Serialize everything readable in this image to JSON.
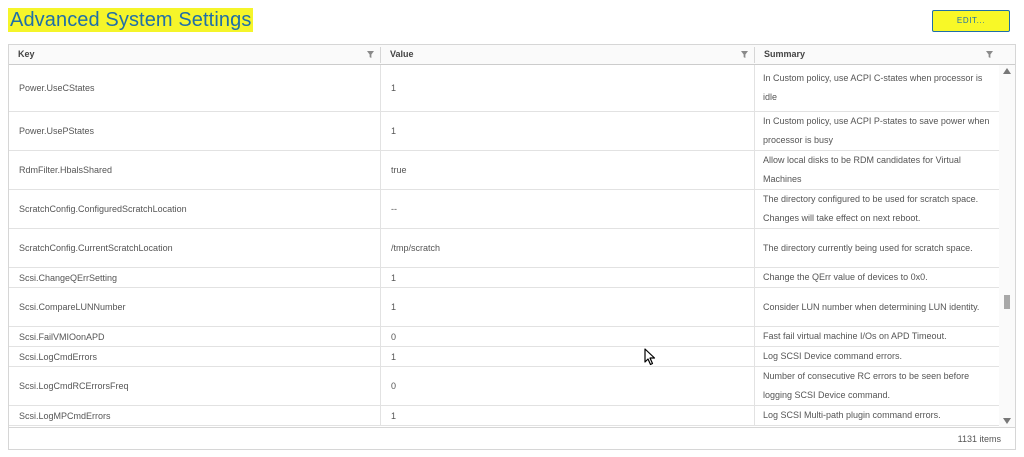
{
  "page": {
    "title": "Advanced System Settings",
    "edit_label": "EDIT..."
  },
  "colors": {
    "highlight": "#f5f52a",
    "accent": "#1f6fa8"
  },
  "grid": {
    "columns": [
      "Key",
      "Value",
      "Summary"
    ],
    "rows": [
      {
        "key": "Power.UseCStates",
        "value": "1",
        "summary": "In Custom policy, use ACPI C-states when processor is idle"
      },
      {
        "key": "Power.UsePStates",
        "value": "1",
        "summary": "In Custom policy, use ACPI P-states to save power when processor is busy"
      },
      {
        "key": "RdmFilter.HbalsShared",
        "value": "true",
        "summary": "Allow local disks to be RDM candidates for Virtual Machines"
      },
      {
        "key": "ScratchConfig.ConfiguredScratchLocation",
        "value": "--",
        "summary": "The directory configured to be used for scratch space. Changes will take effect on next reboot."
      },
      {
        "key": "ScratchConfig.CurrentScratchLocation",
        "value": "/tmp/scratch",
        "summary": "The directory currently being used for scratch space."
      },
      {
        "key": "Scsi.ChangeQErrSetting",
        "value": "1",
        "summary": "Change the QErr value of devices to 0x0."
      },
      {
        "key": "Scsi.CompareLUNNumber",
        "value": "1",
        "summary": "Consider LUN number when determining LUN identity."
      },
      {
        "key": "Scsi.FailVMIOonAPD",
        "value": "0",
        "summary": "Fast fail virtual machine I/Os on APD Timeout."
      },
      {
        "key": "Scsi.LogCmdErrors",
        "value": "1",
        "summary": "Log SCSI Device command errors."
      },
      {
        "key": "Scsi.LogCmdRCErrorsFreq",
        "value": "0",
        "summary": "Number of consecutive RC errors to be seen before logging SCSI Device command."
      },
      {
        "key": "Scsi.LogMPCmdErrors",
        "value": "1",
        "summary": "Log SCSI Multi-path plugin command errors."
      }
    ],
    "footer": {
      "items_count": "1131 items"
    }
  }
}
